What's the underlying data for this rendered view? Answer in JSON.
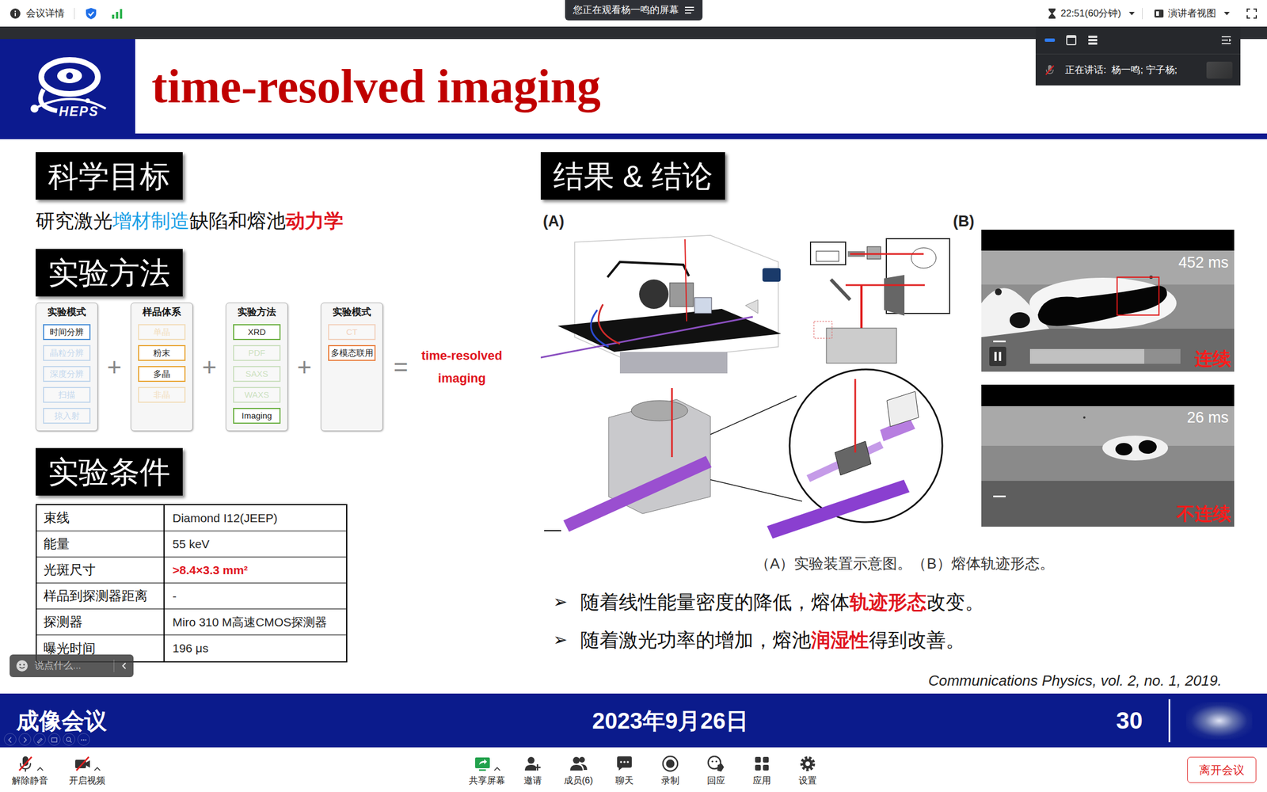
{
  "top_bar": {
    "meeting_info": "会议详情",
    "viewing_banner": "您正在观看杨一鸣的屏幕",
    "timer": "22:51(60分钟)",
    "view_mode": "演讲者视图"
  },
  "speaker_panel": {
    "speaking": "正在讲话:  杨一鸣; 宁子杨;"
  },
  "slide": {
    "logo_text": "HEPS",
    "title": "time-resolved imaging",
    "goal": {
      "heading": "科学目标",
      "parts": [
        {
          "text": "研究激光",
          "color": "#111111",
          "bold": false
        },
        {
          "text": "增材制造",
          "color": "#19a0e6",
          "bold": false
        },
        {
          "text": "缺陷和熔池",
          "color": "#111111",
          "bold": false
        },
        {
          "text": "动力学",
          "color": "#e0141e",
          "bold": true
        }
      ]
    },
    "method": {
      "heading": "实验方法",
      "groups": [
        {
          "title": "实验模式",
          "color": "#4a8fd8",
          "items": [
            {
              "label": "时间分辨",
              "active": true
            },
            {
              "label": "晶粒分辨",
              "active": false
            },
            {
              "label": "深度分辨",
              "active": false
            },
            {
              "label": "扫描",
              "active": false
            },
            {
              "label": "掠入射",
              "active": false
            }
          ]
        },
        {
          "title": "样品体系",
          "color": "#e9a534",
          "items": [
            {
              "label": "单晶",
              "active": false
            },
            {
              "label": "粉末",
              "active": true
            },
            {
              "label": "多晶",
              "active": true
            },
            {
              "label": "非晶",
              "active": false
            }
          ]
        },
        {
          "title": "实验方法",
          "color": "#6bb042",
          "items": [
            {
              "label": "XRD",
              "active": true
            },
            {
              "label": "PDF",
              "active": false
            },
            {
              "label": "SAXS",
              "active": false
            },
            {
              "label": "WAXS",
              "active": false
            },
            {
              "label": "Imaging",
              "active": true
            }
          ]
        },
        {
          "title": "实验模式",
          "color": "#ea7d3c",
          "items": [
            {
              "label": "CT",
              "active": false
            },
            {
              "label": "多模态联用",
              "active": true
            }
          ]
        }
      ],
      "operators": [
        "+",
        "+",
        "+",
        "="
      ],
      "result": "time-resolved imaging"
    },
    "conditions": {
      "heading": "实验条件",
      "rows": [
        {
          "label": "束线",
          "value": "Diamond I12(JEEP)",
          "highlight": false
        },
        {
          "label": "能量",
          "value": "55 keV",
          "highlight": false
        },
        {
          "label": "光斑尺寸",
          "value": ">8.4×3.3 mm²",
          "highlight": true
        },
        {
          "label": "样品到探测器距离",
          "value": "-",
          "highlight": false
        },
        {
          "label": "探测器",
          "value": "Miro 310 M高速CMOS探测器",
          "highlight": false
        },
        {
          "label": "曝光时间",
          "value": "196 μs",
          "highlight": false
        }
      ]
    },
    "results": {
      "heading": "结果 & 结论",
      "panel_a_label": "(A)",
      "panel_b_label": "(B)",
      "frames": [
        {
          "time": "452 ms",
          "tag": "连续",
          "kind": "continuous",
          "video": {
            "playing": true,
            "level": 0.76
          }
        },
        {
          "time": "26 ms",
          "tag": "不连续",
          "kind": "discontinuous"
        }
      ],
      "caption": "（A）实验装置示意图。（B）熔体轨迹形态。",
      "bullets": [
        {
          "marker": "➢",
          "parts": [
            {
              "text": "随着线性能量密度的降低，熔体",
              "emphasis": false
            },
            {
              "text": "轨迹形态",
              "emphasis": true
            },
            {
              "text": "改变。",
              "emphasis": false
            }
          ]
        },
        {
          "marker": "➢",
          "parts": [
            {
              "text": "随着激光功率的增加，熔池",
              "emphasis": false
            },
            {
              "text": "润湿性",
              "emphasis": true
            },
            {
              "text": "得到改善。",
              "emphasis": false
            }
          ]
        }
      ],
      "citation": "Communications Physics, vol. 2, no. 1, 2019."
    },
    "footer": {
      "left": "成像会议",
      "date": "2023年9月26日",
      "page": "30"
    }
  },
  "chat_input": {
    "placeholder": "说点什么..."
  },
  "toolbar": {
    "left": [
      {
        "label": "解除静音",
        "kind": "mic-off",
        "has_menu": true
      },
      {
        "label": "开启视频",
        "kind": "video-off",
        "has_menu": true
      }
    ],
    "center": [
      {
        "label": "共享屏幕",
        "kind": "share",
        "has_menu": true
      },
      {
        "label": "邀请",
        "kind": "invite",
        "has_menu": false
      },
      {
        "label": "成员(6)",
        "kind": "members",
        "has_menu": false
      },
      {
        "label": "聊天",
        "kind": "chat",
        "has_menu": false
      },
      {
        "label": "录制",
        "kind": "record",
        "has_menu": false
      },
      {
        "label": "回应",
        "kind": "react",
        "has_menu": false
      },
      {
        "label": "应用",
        "kind": "apps",
        "has_menu": false
      },
      {
        "label": "设置",
        "kind": "settings",
        "has_menu": false
      }
    ],
    "leave": "离开会议"
  }
}
